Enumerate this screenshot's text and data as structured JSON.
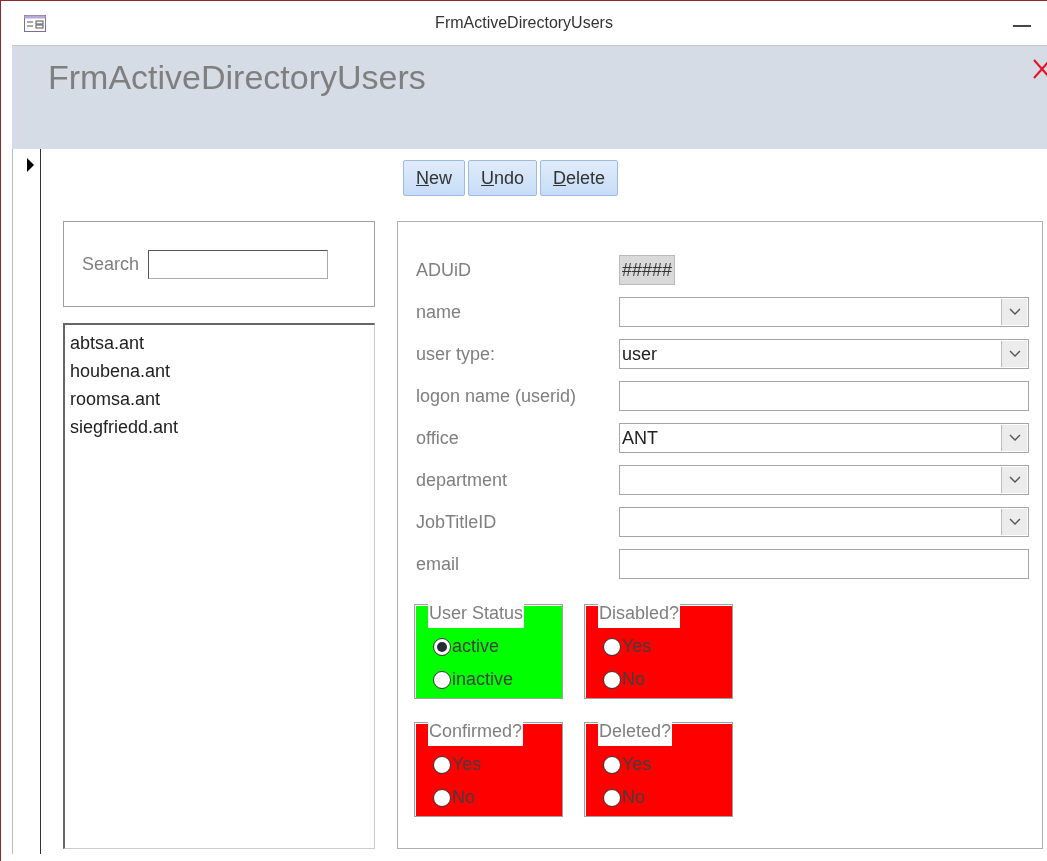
{
  "window": {
    "title": "FrmActiveDirectoryUsers"
  },
  "header": {
    "title": "FrmActiveDirectoryUsers"
  },
  "buttons": [
    {
      "label": "New"
    },
    {
      "label": "Undo"
    },
    {
      "label": "Delete"
    }
  ],
  "search": {
    "label": "Search"
  },
  "user_list": [
    "abtsa.ant",
    "houbena.ant",
    "roomsa.ant",
    "siegfriedd.ant"
  ],
  "fields": [
    {
      "label": "ADUiD",
      "kind": "readonly",
      "value": "#####"
    },
    {
      "label": "name",
      "kind": "combo"
    },
    {
      "label": "user type:",
      "kind": "combo",
      "value": "user"
    },
    {
      "label": "logon name (userid)",
      "kind": "text"
    },
    {
      "label": "office",
      "kind": "combo",
      "value": "ANT"
    },
    {
      "label": "department",
      "kind": "combo"
    },
    {
      "label": "JobTitleID",
      "kind": "combo"
    },
    {
      "label": "email",
      "kind": "text"
    }
  ],
  "option_groups": [
    {
      "title": "User Status",
      "color": "#00ff00",
      "options": [
        {
          "label": "active",
          "selected": true
        },
        {
          "label": "inactive",
          "selected": false
        }
      ]
    },
    {
      "title": "Disabled?",
      "color": "#ff0000",
      "options": [
        {
          "label": "Yes",
          "selected": false
        },
        {
          "label": "No",
          "selected": false
        }
      ]
    },
    {
      "title": "Confirmed?",
      "color": "#ff0000",
      "options": [
        {
          "label": "Yes",
          "selected": false
        },
        {
          "label": "No",
          "selected": false
        }
      ]
    },
    {
      "title": "Deleted?",
      "color": "#ff0000",
      "options": [
        {
          "label": "Yes",
          "selected": false
        },
        {
          "label": "No",
          "selected": false
        }
      ]
    }
  ]
}
